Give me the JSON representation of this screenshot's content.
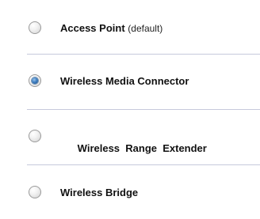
{
  "modes": {
    "options": [
      {
        "label": "Access Point",
        "suffix": "(default)",
        "selected": false
      },
      {
        "label": "Wireless Media Connector",
        "suffix": "",
        "selected": true
      },
      {
        "label": "Wireless  Range  Extender",
        "suffix": "",
        "selected": false
      },
      {
        "label": "Wireless Bridge",
        "suffix": "",
        "selected": false
      }
    ]
  },
  "colors": {
    "divider": "#c6c9dc",
    "radio_selected": "#3f7fc1"
  }
}
